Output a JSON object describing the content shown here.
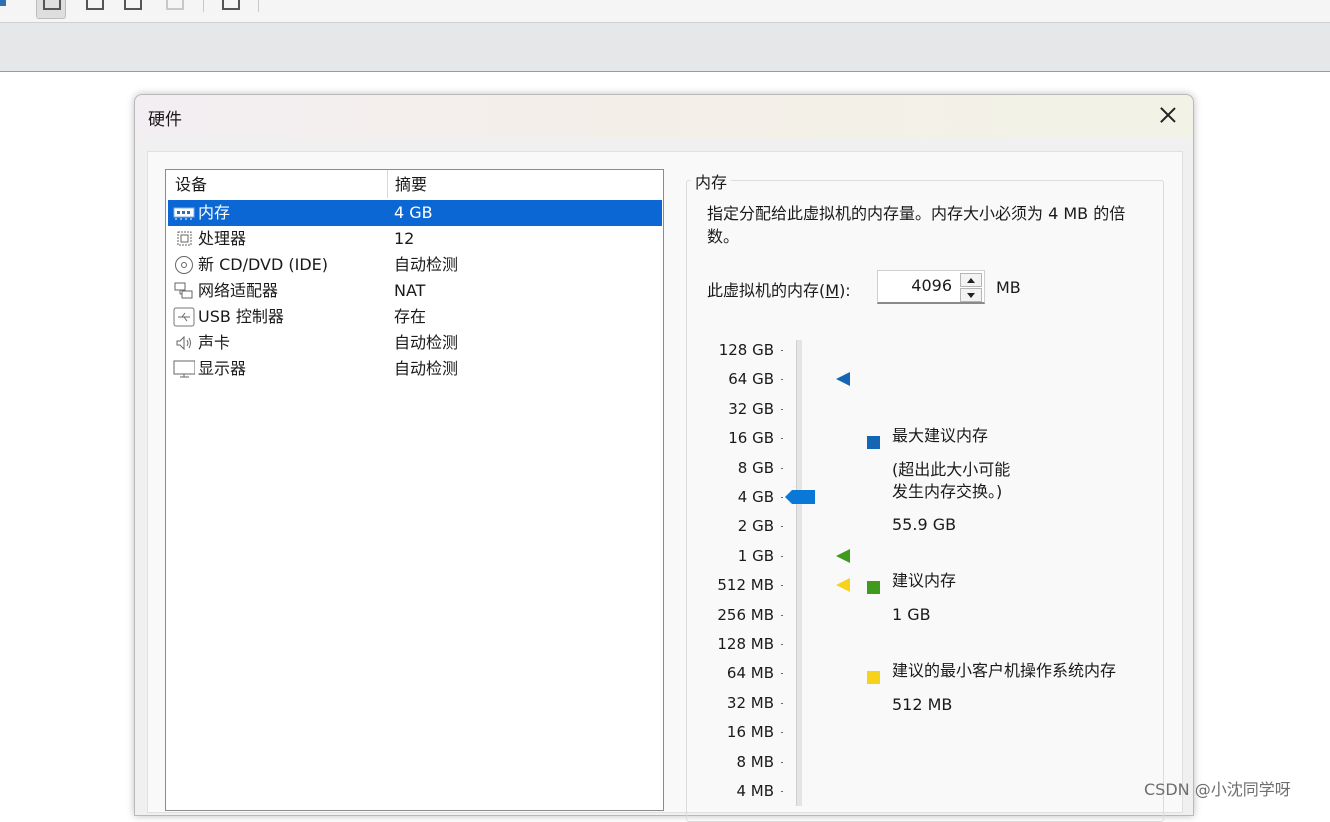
{
  "dialog": {
    "title": "硬件"
  },
  "devices": {
    "header": {
      "device": "设备",
      "summary": "摘要"
    },
    "rows": [
      {
        "icon": "memory-icon",
        "name": "内存",
        "summary": "4 GB",
        "selected": true
      },
      {
        "icon": "processor-icon",
        "name": "处理器",
        "summary": "12",
        "selected": false
      },
      {
        "icon": "cd-dvd-icon",
        "name": "新 CD/DVD (IDE)",
        "summary": "自动检测",
        "selected": false
      },
      {
        "icon": "network-adapter-icon",
        "name": "网络适配器",
        "summary": "NAT",
        "selected": false
      },
      {
        "icon": "usb-icon",
        "name": "USB 控制器",
        "summary": "存在",
        "selected": false
      },
      {
        "icon": "speaker-icon",
        "name": "声卡",
        "summary": "自动检测",
        "selected": false
      },
      {
        "icon": "monitor-icon",
        "name": "显示器",
        "summary": "自动检测",
        "selected": false
      }
    ]
  },
  "memory": {
    "group_title": "内存",
    "description": "指定分配给此虚拟机的内存量。内存大小必须为 4 MB 的倍数。",
    "label_prefix": "此虚拟机的内存(",
    "label_mnemonic": "M",
    "label_suffix": "):",
    "value": "4096",
    "unit": "MB",
    "scale": [
      "128 GB",
      "64 GB",
      "32 GB",
      "16 GB",
      "8 GB",
      "4 GB",
      "2 GB",
      "1 GB",
      "512 MB",
      "256 MB",
      "128 MB",
      "64 MB",
      "32 MB",
      "16 MB",
      "8 MB",
      "4 MB"
    ],
    "current_scale_index": 5,
    "markers": [
      {
        "name": "max-recommended",
        "scale_index": 1,
        "color": "#1565b5"
      },
      {
        "name": "recommended",
        "scale_index": 7,
        "color": "#3f9a1f"
      },
      {
        "name": "min-guest-os",
        "scale_index": 8,
        "color": "#f7d21a"
      }
    ],
    "legend": {
      "max": {
        "title": "最大建议内存",
        "note_line1": "(超出此大小可能",
        "note_line2": "发生内存交换。)",
        "value": "55.9 GB",
        "color": "#1565b5"
      },
      "recommended": {
        "title": "建议内存",
        "value": "1 GB",
        "color": "#3f9a1f"
      },
      "min": {
        "title": "建议的最小客户机操作系统内存",
        "value": "512 MB",
        "color": "#f7d21a"
      }
    },
    "thumb_color": "#0a78d7"
  },
  "watermark": "CSDN @小沈同学呀"
}
